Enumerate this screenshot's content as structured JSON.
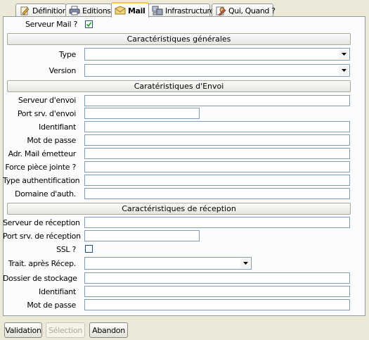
{
  "tabs": [
    {
      "label": "Définition",
      "icon": "pencil-icon",
      "active": false
    },
    {
      "label": "Editions",
      "icon": "printer-icon",
      "active": false
    },
    {
      "label": "Mail",
      "icon": "mail-icon",
      "active": true
    },
    {
      "label": "Infrastructure",
      "icon": "computer-icon",
      "active": false
    },
    {
      "label": "Qui, Quand ?",
      "icon": "user-icon",
      "active": false
    }
  ],
  "serveur_mail": {
    "label": "Serveur Mail ?",
    "checked": true
  },
  "sections": {
    "generales": "Caractéristiques générales",
    "envoi": "Caratéristiques d'Envoi",
    "reception": "Caractéristiques de réception"
  },
  "general": {
    "type_label": "Type",
    "type_value": "",
    "version_label": "Version",
    "version_value": ""
  },
  "envoi": {
    "serveur_label": "Serveur d'envoi",
    "serveur_value": "",
    "port_label": "Port srv. d'envoi",
    "port_value": "",
    "identifiant_label": "Identifiant",
    "identifiant_value": "",
    "mdp_label": "Mot de passe",
    "mdp_value": "",
    "emetteur_label": "Adr. Mail émetteur",
    "emetteur_value": "",
    "force_label": "Force pièce jointe ?",
    "force_value": "",
    "auth_label": "Type authentification",
    "auth_value": "",
    "domaine_label": "Domaine d'auth.",
    "domaine_value": ""
  },
  "reception": {
    "serveur_label": "Serveur de réception",
    "serveur_value": "",
    "port_label": "Port srv. de réception",
    "port_value": "",
    "ssl_label": "SSL ?",
    "ssl_checked": false,
    "trait_label": "Trait. après Récep.",
    "trait_value": "",
    "dossier_label": "Dossier de stockage",
    "dossier_value": "",
    "identifiant_label": "Identifiant",
    "identifiant_value": "",
    "mdp_label": "Mot de passe",
    "mdp_value": ""
  },
  "buttons": {
    "validation": "Validation",
    "selection": "Sélection",
    "abandon": "Abandon"
  },
  "colors": {
    "active_tab_accent": "#ffc83c",
    "field_border": "#7f9db9",
    "background": "#ece9d8"
  }
}
